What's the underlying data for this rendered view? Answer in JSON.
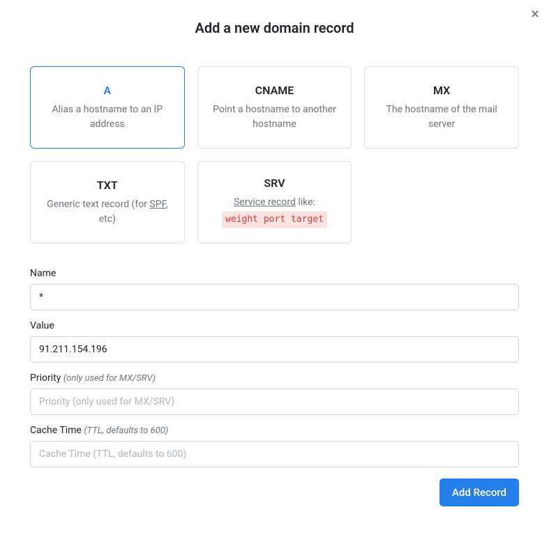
{
  "modal": {
    "title": "Add a new domain record",
    "close_icon": "×"
  },
  "record_types": [
    {
      "name": "A",
      "desc": "Alias a hostname to an IP address",
      "selected": true
    },
    {
      "name": "CNAME",
      "desc": "Point a hostname to another hostname",
      "selected": false
    },
    {
      "name": "MX",
      "desc": "The hostname of the mail server",
      "selected": false
    },
    {
      "name": "TXT",
      "desc_prefix": "Generic text record (for ",
      "desc_link": "SPF",
      "desc_suffix": ", etc)",
      "selected": false
    },
    {
      "name": "SRV",
      "desc_link": "Service record",
      "desc_mid": " like:",
      "code": "weight port target",
      "selected": false
    }
  ],
  "form": {
    "name": {
      "label": "Name",
      "value": "*"
    },
    "value": {
      "label": "Value",
      "value": "91.211.154.196"
    },
    "priority": {
      "label": "Priority",
      "hint": "(only used for MX/SRV)",
      "placeholder": "Priority (only used for MX/SRV)",
      "value": ""
    },
    "cache_time": {
      "label": "Cache Time",
      "hint": "(TTL, defaults to 600)",
      "placeholder": "Cache Time (TTL, defaults to 600)",
      "value": ""
    }
  },
  "actions": {
    "submit": "Add Record"
  }
}
